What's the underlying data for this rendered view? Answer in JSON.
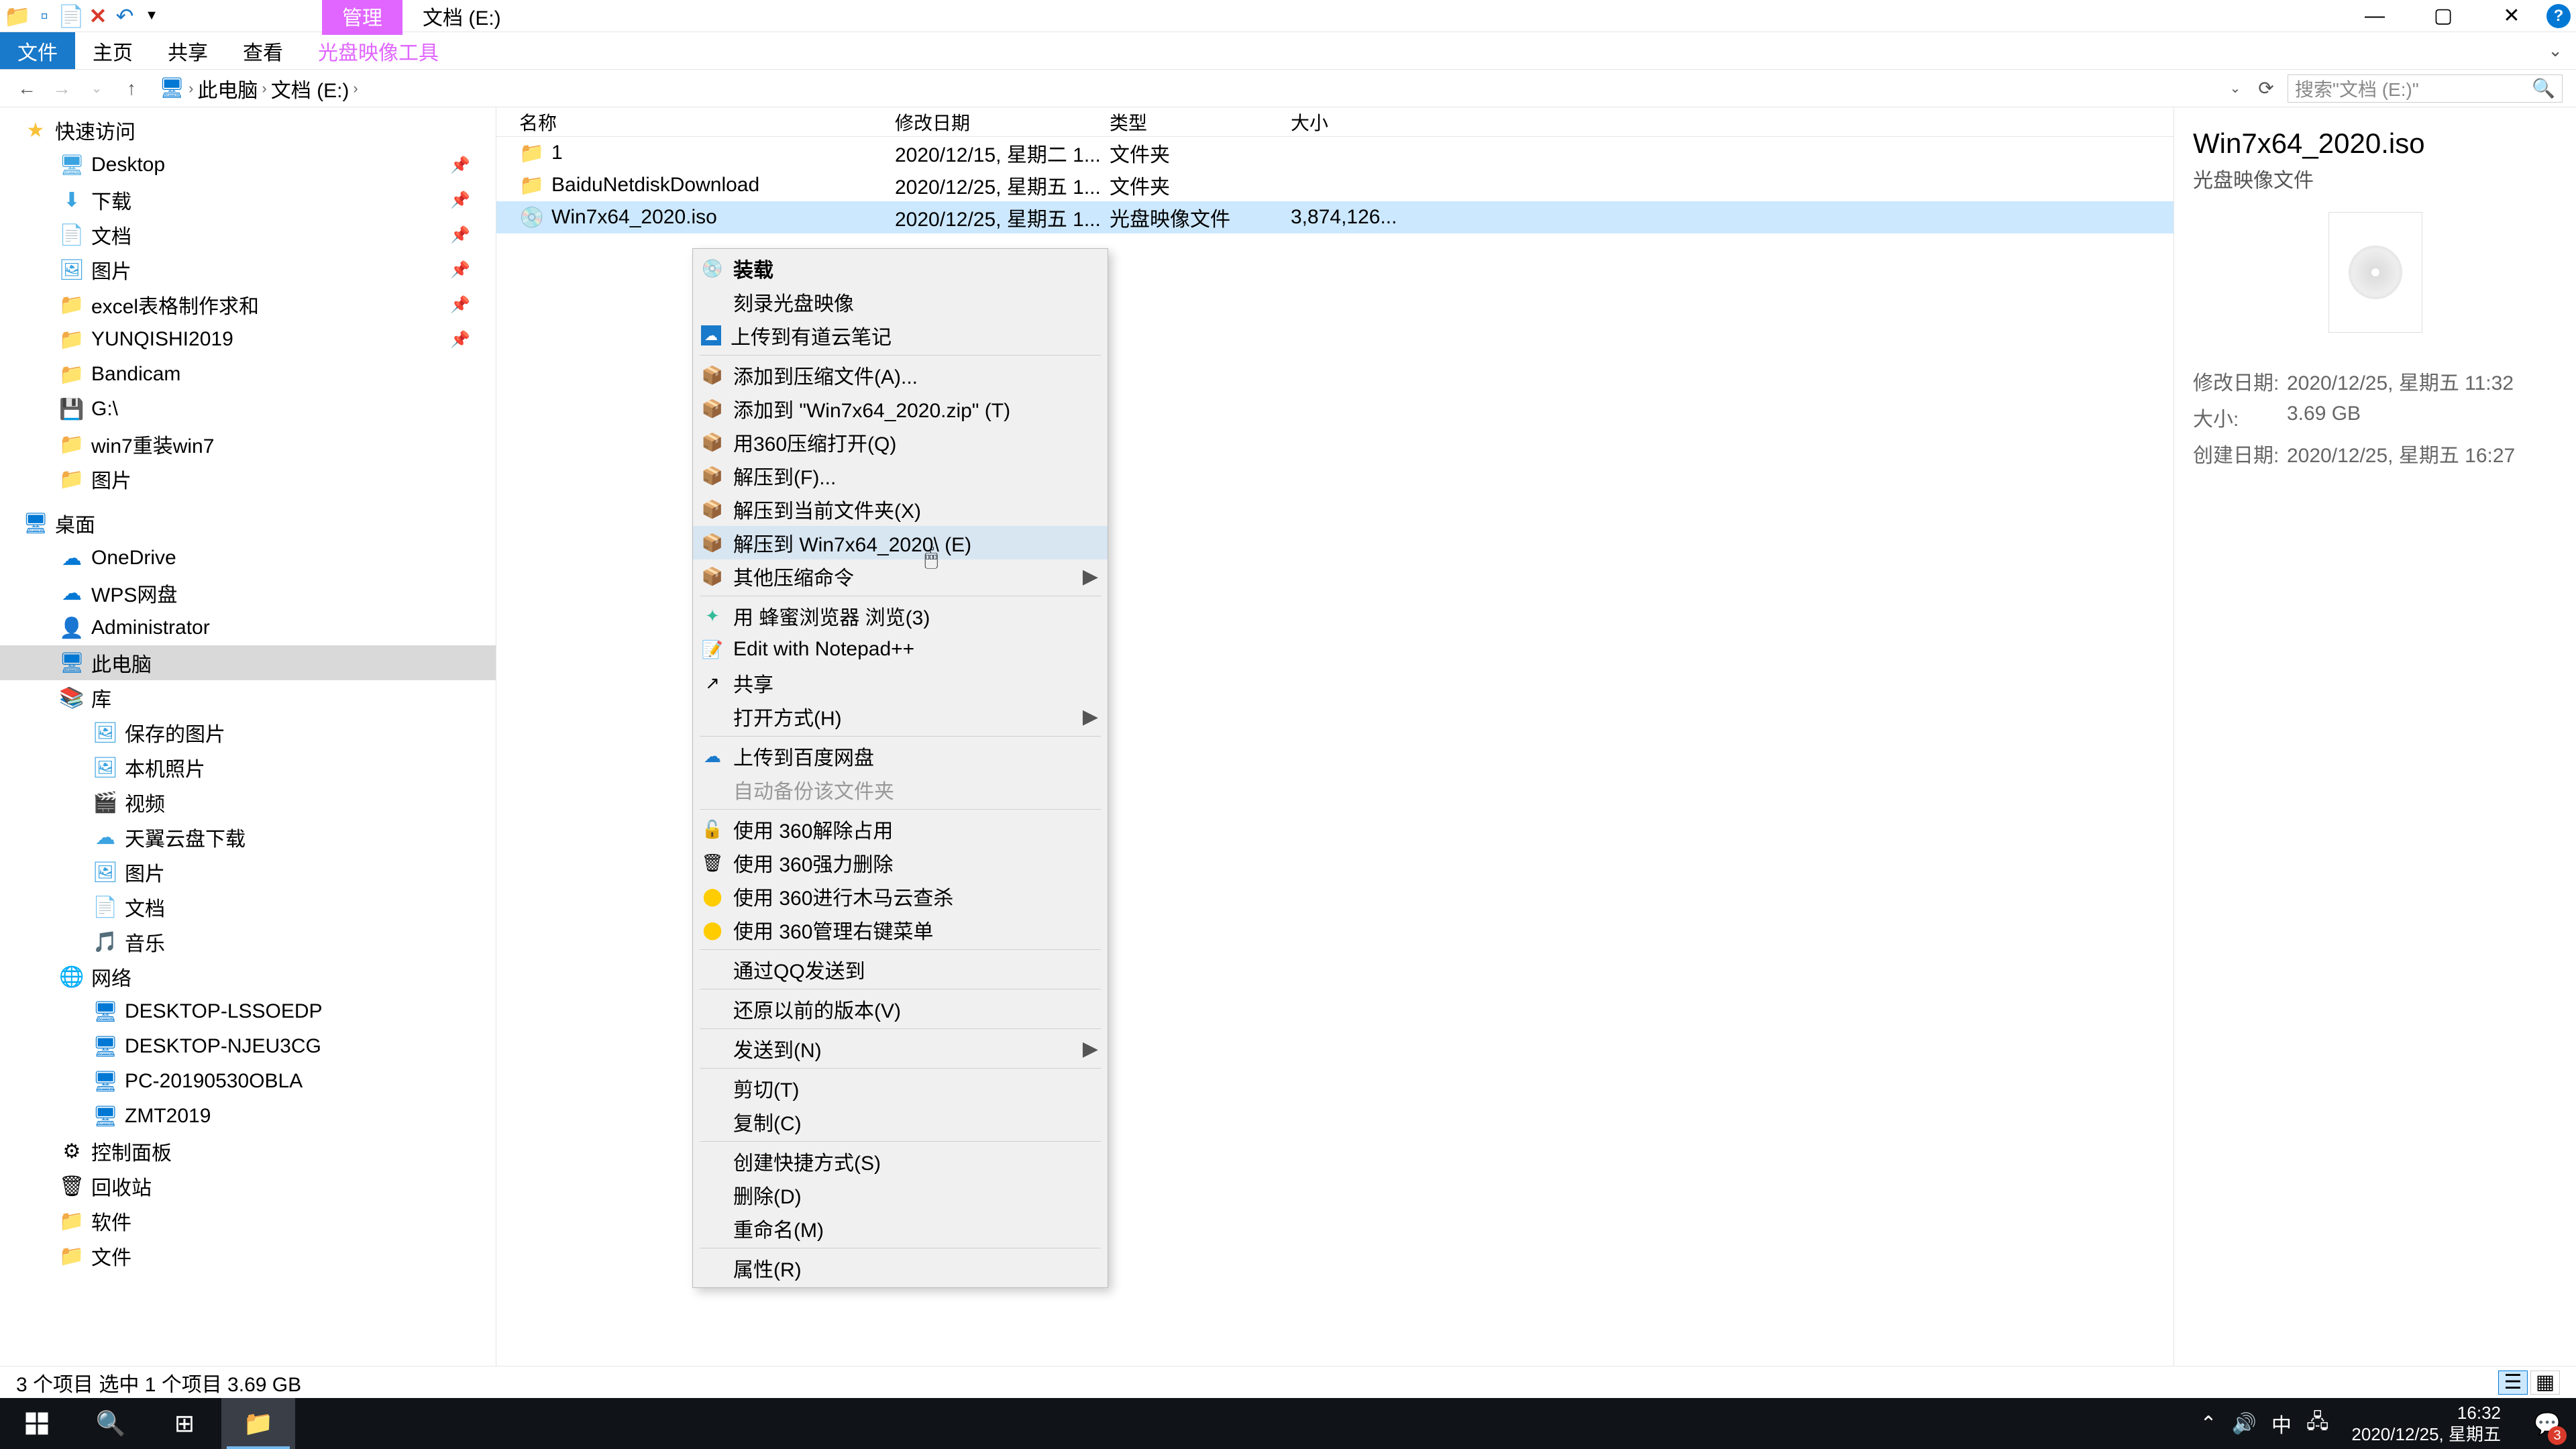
{
  "titlebar": {
    "manage_tab": "管理",
    "drive_tab": "文档 (E:)"
  },
  "win": {
    "help": "?"
  },
  "ribbon": {
    "file": "文件",
    "home": "主页",
    "share": "共享",
    "view": "查看",
    "disc_tools": "光盘映像工具"
  },
  "breadcrumb": {
    "root": "此电脑",
    "drive": "文档 (E:)"
  },
  "search": {
    "placeholder": "搜索\"文档 (E:)\""
  },
  "cols": {
    "name": "名称",
    "date": "修改日期",
    "type": "类型",
    "size": "大小"
  },
  "files": [
    {
      "name": "1",
      "date": "2020/12/15, 星期二 1...",
      "type": "文件夹",
      "size": "",
      "icon": "folder"
    },
    {
      "name": "BaiduNetdiskDownload",
      "date": "2020/12/25, 星期五 1...",
      "type": "文件夹",
      "size": "",
      "icon": "folder"
    },
    {
      "name": "Win7x64_2020.iso",
      "date": "2020/12/25, 星期五 1...",
      "type": "光盘映像文件",
      "size": "3,874,126...",
      "icon": "file",
      "selected": true
    }
  ],
  "sidebar": {
    "quick": "快速访问",
    "items_quick": [
      "Desktop",
      "下载",
      "文档",
      "图片",
      "excel表格制作求和",
      "YUNQISHI2019",
      "Bandicam",
      "G:\\",
      "win7重装win7",
      "图片"
    ],
    "desktop": "桌面",
    "items_desktop": [
      "OneDrive",
      "WPS网盘",
      "Administrator",
      "此电脑",
      "库"
    ],
    "lib_items": [
      "保存的图片",
      "本机照片",
      "视频",
      "天翼云盘下载",
      "图片",
      "文档",
      "音乐"
    ],
    "network": "网络",
    "net_items": [
      "DESKTOP-LSSOEDP",
      "DESKTOP-NJEU3CG",
      "PC-20190530OBLA",
      "ZMT2019"
    ],
    "others": [
      "控制面板",
      "回收站",
      "软件",
      "文件"
    ]
  },
  "ctx": {
    "mount": "装载",
    "burn": "刻录光盘映像",
    "youdao": "上传到有道云笔记",
    "add_archive": "添加到压缩文件(A)...",
    "add_zip": "添加到 \"Win7x64_2020.zip\" (T)",
    "open_360": "用360压缩打开(Q)",
    "extract_to": "解压到(F)...",
    "extract_here": "解压到当前文件夹(X)",
    "extract_named": "解压到 Win7x64_2020\\ (E)",
    "other_compress": "其他压缩命令",
    "honey_browser": "用 蜂蜜浏览器 浏览(3)",
    "edit_npp": "Edit with Notepad++",
    "share": "共享",
    "open_with": "打开方式(H)",
    "upload_baidu": "上传到百度网盘",
    "auto_backup": "自动备份该文件夹",
    "use_360_unlock": "使用 360解除占用",
    "use_360_force_del": "使用 360强力删除",
    "use_360_scan": "使用 360进行木马云查杀",
    "use_360_ctx": "使用 360管理右键菜单",
    "qq_send": "通过QQ发送到",
    "restore_prev": "还原以前的版本(V)",
    "send_to": "发送到(N)",
    "cut": "剪切(T)",
    "copy": "复制(C)",
    "shortcut": "创建快捷方式(S)",
    "delete": "删除(D)",
    "rename": "重命名(M)",
    "properties": "属性(R)"
  },
  "details": {
    "title": "Win7x64_2020.iso",
    "subtitle": "光盘映像文件",
    "rows": [
      {
        "label": "修改日期:",
        "value": "2020/12/25, 星期五 11:32"
      },
      {
        "label": "大小:",
        "value": "3.69 GB"
      },
      {
        "label": "创建日期:",
        "value": "2020/12/25, 星期五 16:27"
      }
    ]
  },
  "status": {
    "left": "3 个项目    选中 1 个项目  3.69 GB"
  },
  "taskbar": {
    "time": "16:32",
    "date": "2020/12/25, 星期五",
    "ime": "中",
    "notif_count": "3"
  }
}
